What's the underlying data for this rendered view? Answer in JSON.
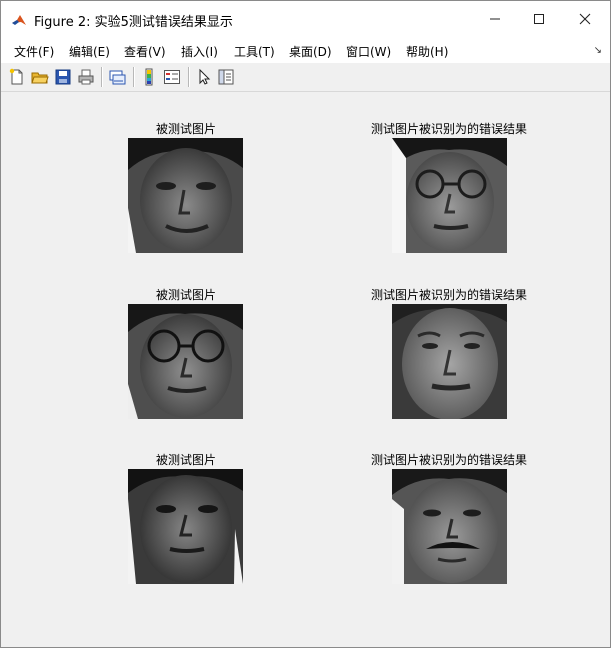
{
  "window": {
    "title": "Figure 2: 实验5测试错误结果显示"
  },
  "menu": [
    {
      "label": "文件(F)"
    },
    {
      "label": "编辑(E)"
    },
    {
      "label": "查看(V)"
    },
    {
      "label": "插入(I)"
    },
    {
      "label": "工具(T)"
    },
    {
      "label": "桌面(D)"
    },
    {
      "label": "窗口(W)"
    },
    {
      "label": "帮助(H)"
    }
  ],
  "toolbar": [
    {
      "icon": "new-figure-icon"
    },
    {
      "icon": "open-folder-icon"
    },
    {
      "icon": "save-icon"
    },
    {
      "icon": "print-icon"
    },
    {
      "icon": "link-plot-icon"
    },
    {
      "icon": "colorbar-icon"
    },
    {
      "icon": "legend-icon"
    },
    {
      "icon": "pointer-icon"
    },
    {
      "icon": "property-editor-icon"
    }
  ],
  "panels": {
    "left_title": "被测试图片",
    "right_title": "测试图片被识别为的错误结果",
    "rows": [
      {
        "left": {
          "subject": "male face, dark hair, smiling"
        },
        "right": {
          "subject": "male face with glasses"
        }
      },
      {
        "left": {
          "subject": "male face with glasses"
        },
        "right": {
          "subject": "male face, older, furrowed"
        }
      },
      {
        "left": {
          "subject": "male face, short hair"
        },
        "right": {
          "subject": "male face with mustache"
        }
      }
    ]
  },
  "colors": {
    "titlebar": "#ffffff",
    "background": "#f0f0f0",
    "matlab_orange": "#d9541e",
    "matlab_blue": "#1f4e9b"
  }
}
